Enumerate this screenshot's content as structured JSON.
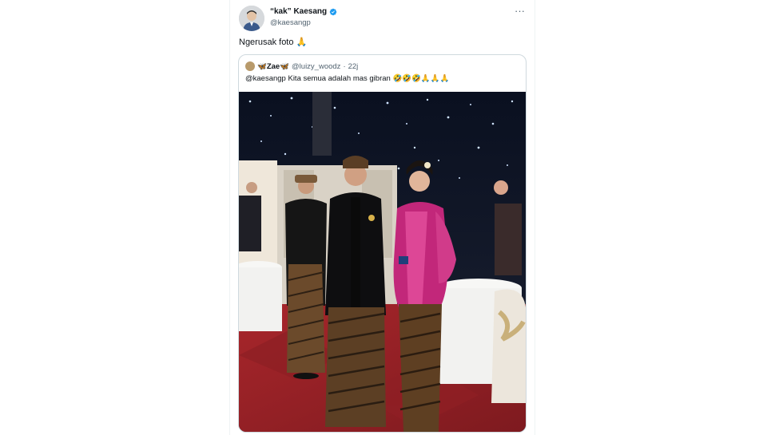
{
  "author": {
    "display_name": "“kak” Kaesang",
    "handle": "@kaesangp",
    "verified": true
  },
  "tweet": {
    "text": "Ngerusak foto 🙏",
    "more_icon": "more-horizontal-icon"
  },
  "quoted_tweet": {
    "display_name": "🦋Zae🦋",
    "handle": "@luizy_woodz",
    "separator": "·",
    "time": "22j",
    "text": "@kaesangp Kita semua adalah mas gibran 🤣🤣🤣🙏🙏🙏"
  },
  "colors": {
    "text_primary": "#0f1419",
    "text_secondary": "#536471",
    "verified_blue": "#1d9bf0",
    "border": "#cfd9de"
  }
}
